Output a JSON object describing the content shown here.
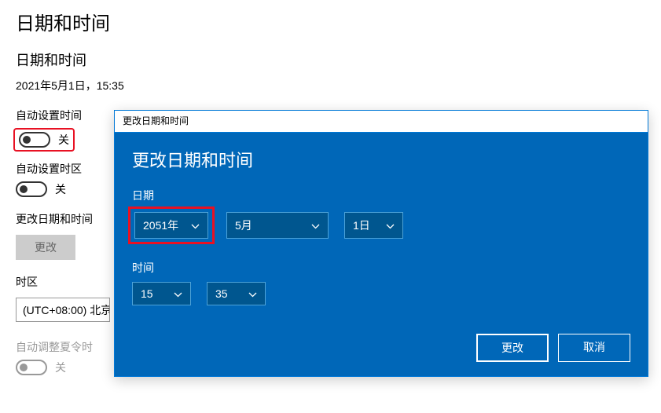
{
  "page": {
    "title": "日期和时间",
    "section_title": "日期和时间",
    "current_datetime": "2021年5月1日，15:35",
    "auto_time_label": "自动设置时间",
    "auto_time_state": "关",
    "auto_tz_label": "自动设置时区",
    "auto_tz_state": "关",
    "change_dt_label": "更改日期和时间",
    "change_button": "更改",
    "tz_label": "时区",
    "tz_value": "(UTC+08:00) 北京",
    "auto_dst_label": "自动调整夏令时",
    "auto_dst_state": "关"
  },
  "dialog": {
    "titlebar": "更改日期和时间",
    "heading": "更改日期和时间",
    "date_label": "日期",
    "year": "2051年",
    "month": "5月",
    "day": "1日",
    "time_label": "时间",
    "hour": "15",
    "minute": "35",
    "confirm": "更改",
    "cancel": "取消"
  }
}
